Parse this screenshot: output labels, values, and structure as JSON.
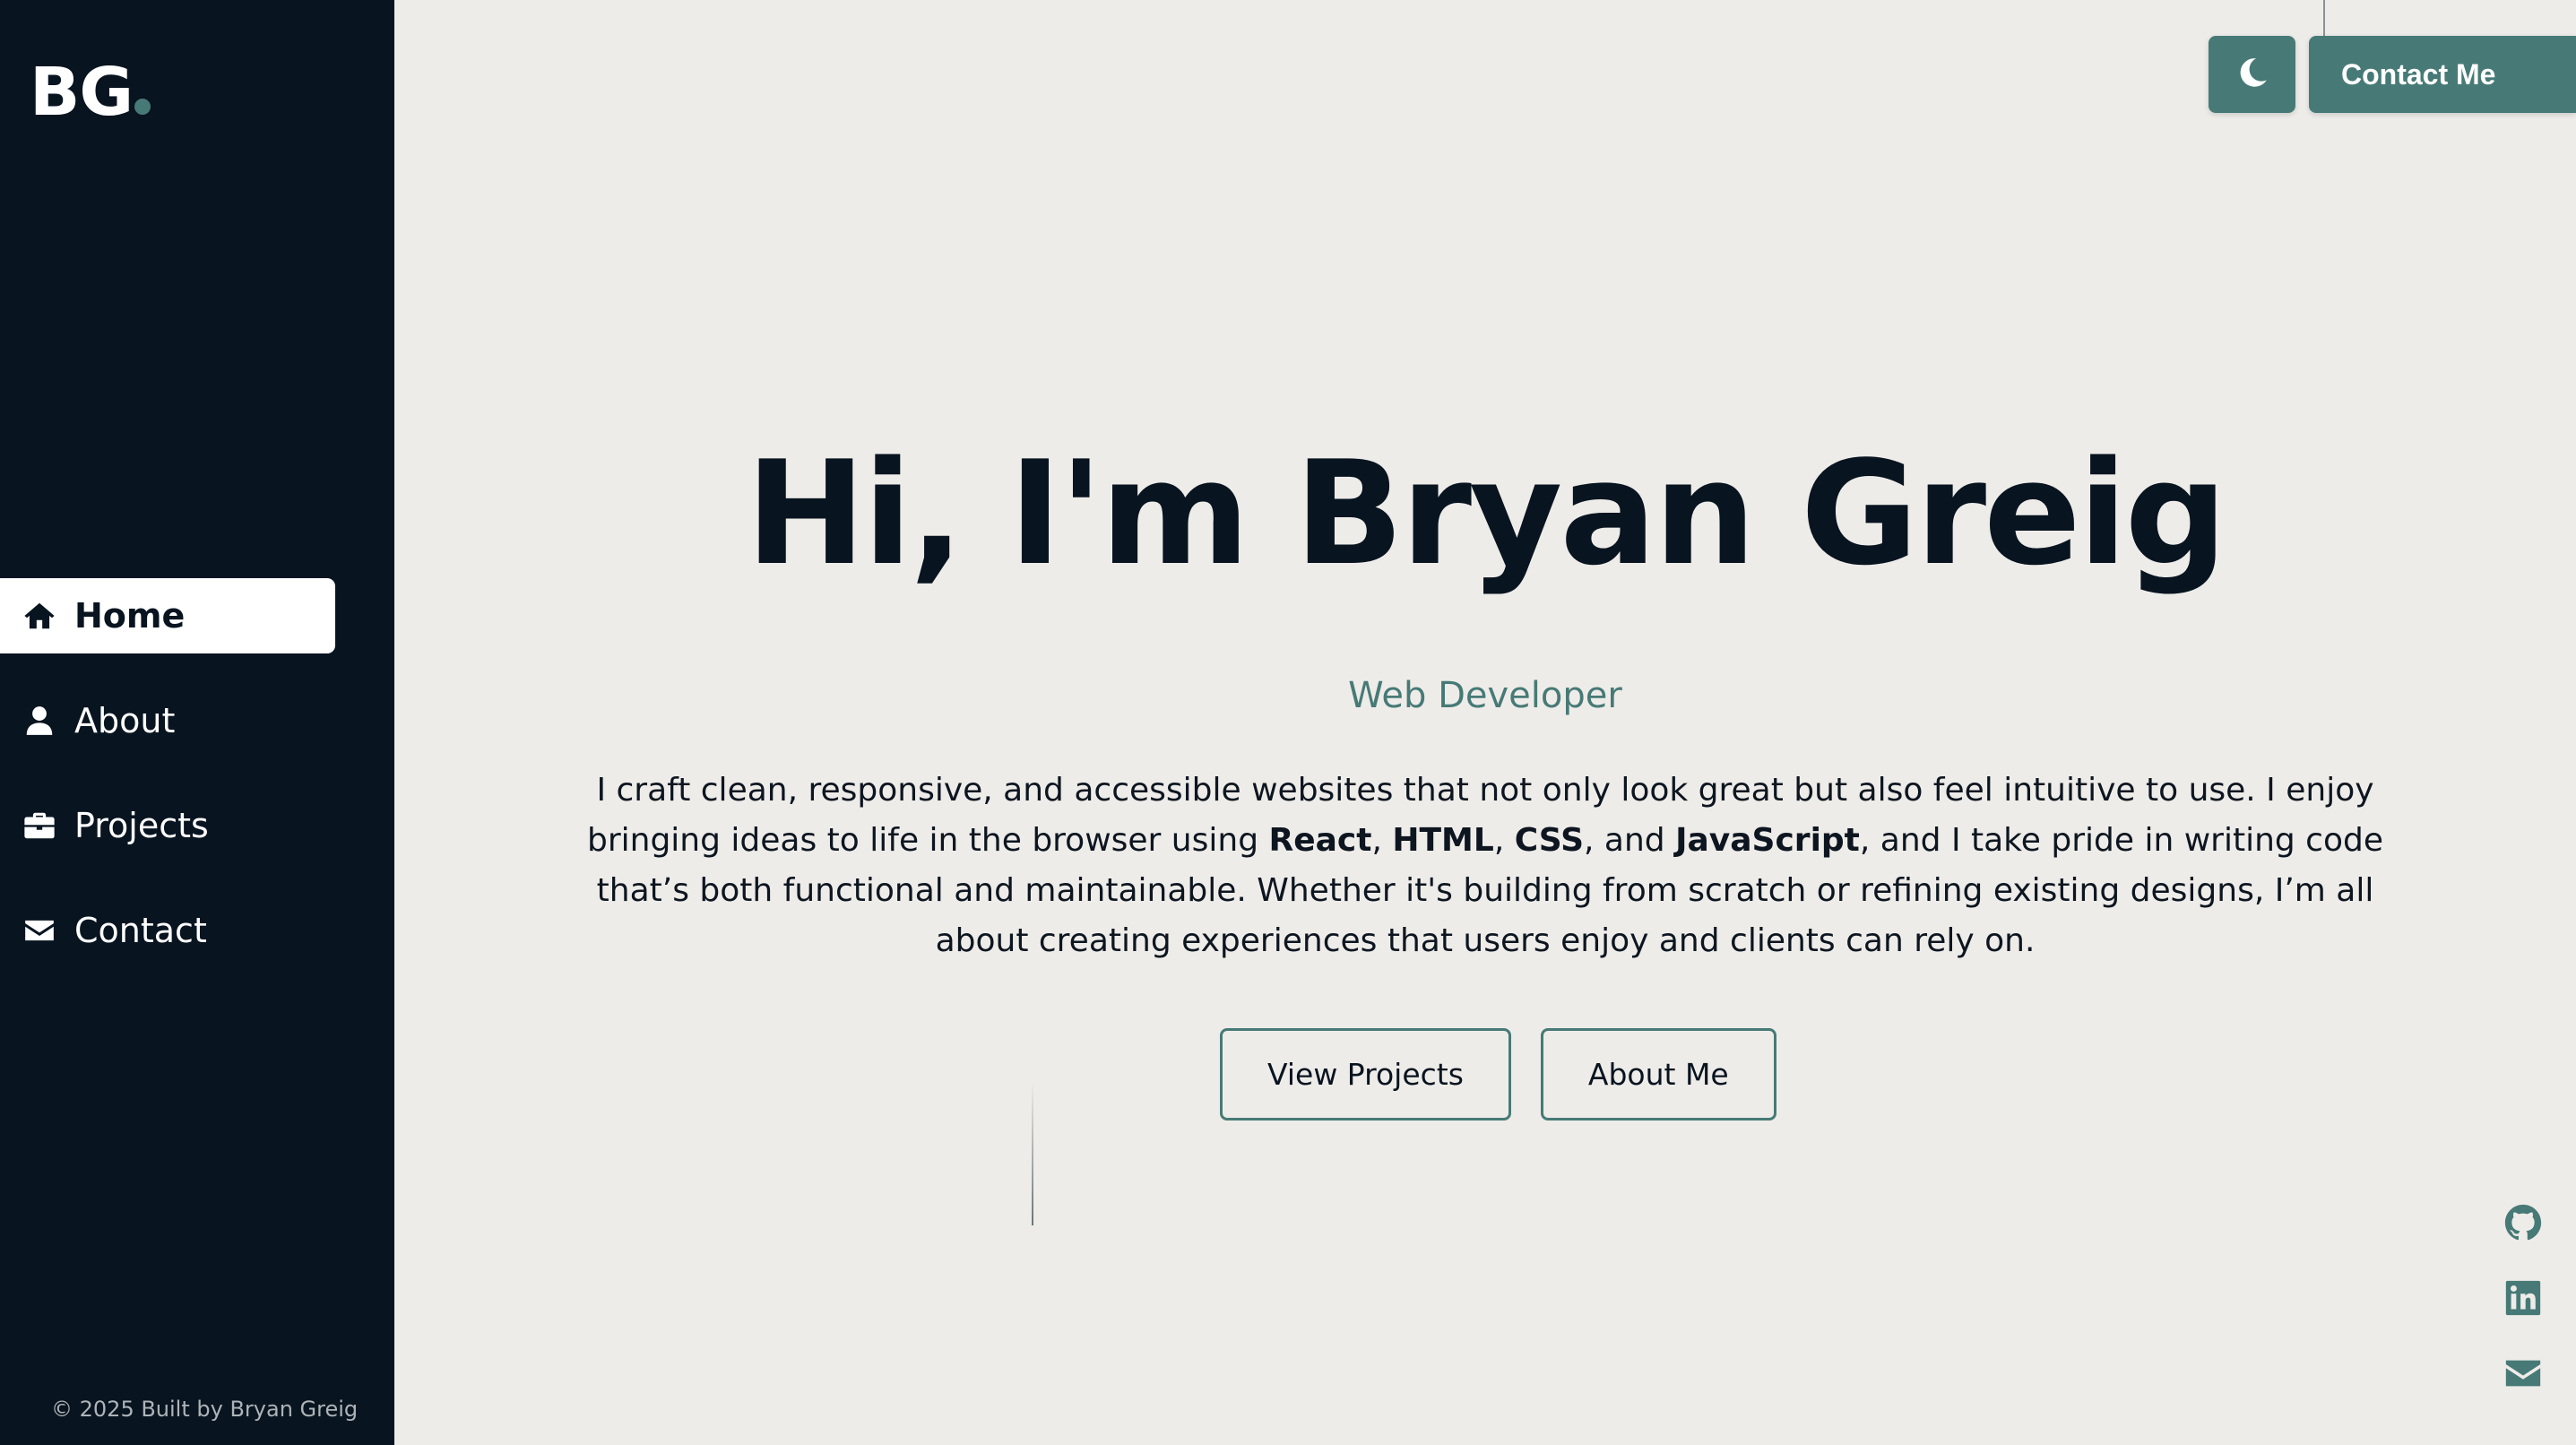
{
  "sidebar": {
    "logo": "BG",
    "nav": [
      {
        "label": "Home",
        "icon": "home-icon",
        "active": true
      },
      {
        "label": "About",
        "icon": "user-icon",
        "active": false
      },
      {
        "label": "Projects",
        "icon": "briefcase-icon",
        "active": false
      },
      {
        "label": "Contact",
        "icon": "envelope-icon",
        "active": false
      }
    ],
    "footer": "© 2025 Built by Bryan Greig"
  },
  "header": {
    "theme_toggle_icon": "moon-icon",
    "contact_label": "Contact Me"
  },
  "hero": {
    "title": "Hi, I'm Bryan Greig",
    "subtitle": "Web Developer",
    "description": {
      "part1": "I craft clean, responsive, and accessible websites that not only look great but also feel intuitive to use. I enjoy bringing ideas to life in the browser using ",
      "tech1": "React",
      "sep1": ", ",
      "tech2": "HTML",
      "sep2": ", ",
      "tech3": "CSS",
      "sep3": ", and ",
      "tech4": "JavaScript",
      "part2": ", and I take pride in writing code that’s both functional and maintainable. Whether it's building from scratch or refining existing designs, I’m all about creating experiences that users enjoy and clients can rely on."
    },
    "primary_button": "View Projects",
    "secondary_button": "About Me"
  },
  "social": [
    "github-icon",
    "linkedin-icon",
    "envelope-icon"
  ],
  "colors": {
    "sidebar_bg": "#081420",
    "page_bg": "#eeece9",
    "accent": "#477a76",
    "text_dark": "#081420"
  }
}
